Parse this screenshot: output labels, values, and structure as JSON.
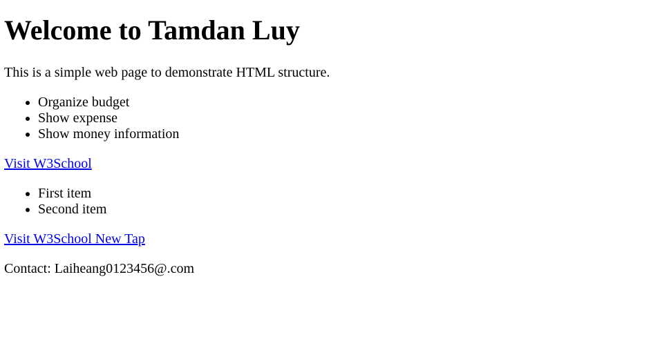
{
  "page": {
    "heading": "Welcome to Tamdan Luy",
    "intro": "This is a simple web page to demonstrate HTML structure.",
    "features": [
      "Organize budget",
      "Show expense",
      "Show money information"
    ],
    "link_one": "Visit W3School",
    "items": [
      "First item",
      "Second item"
    ],
    "link_two": "Visit W3School New Tap",
    "contact": "Contact: Laiheang0123456@.com"
  },
  "colors": {
    "text": "#000000",
    "link": "#0000ee",
    "background": "#ffffff"
  }
}
